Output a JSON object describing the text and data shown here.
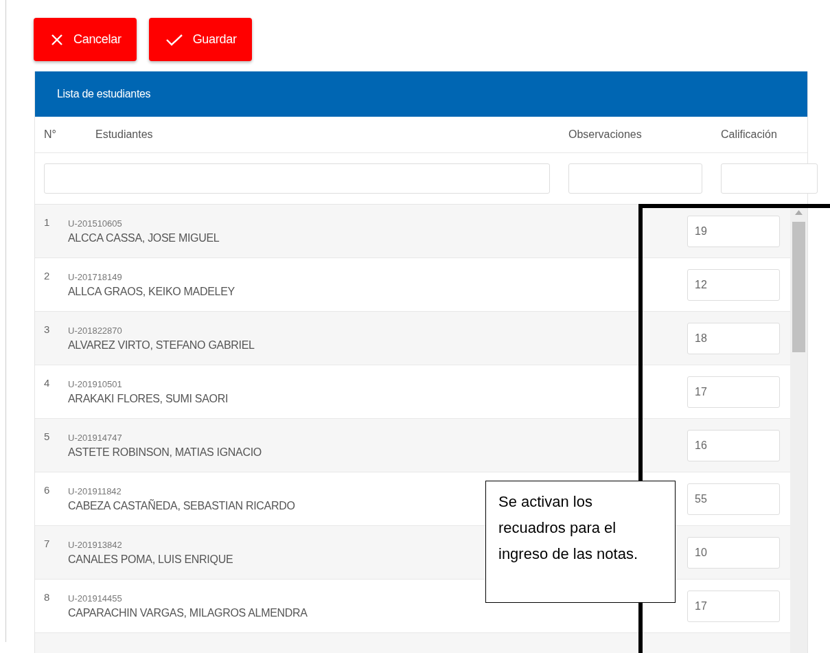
{
  "actions": [
    {
      "kind": "cancel",
      "label": "Cancelar"
    },
    {
      "kind": "save",
      "label": "Guardar"
    }
  ],
  "panel": {
    "title": "Lista de estudiantes",
    "columns": [
      "N°",
      "Estudiantes",
      "Observaciones",
      "Calificación"
    ]
  },
  "students": [
    {
      "number": "1",
      "code": "U-201510605",
      "name": "ALCCA CASSA, JOSE MIGUEL",
      "grade": "19"
    },
    {
      "number": "2",
      "code": "U-201718149",
      "name": "ALLCA GRAOS, KEIKO MADELEY",
      "grade": "12"
    },
    {
      "number": "3",
      "code": "U-201822870",
      "name": "ALVAREZ VIRTO, STEFANO GABRIEL",
      "grade": "18"
    },
    {
      "number": "4",
      "code": "U-201910501",
      "name": "ARAKAKI FLORES, SUMI SAORI",
      "grade": "17"
    },
    {
      "number": "5",
      "code": "U-201914747",
      "name": "ASTETE ROBINSON, MATIAS IGNACIO",
      "grade": "16"
    },
    {
      "number": "6",
      "code": "U-201911842",
      "name": "CABEZA CASTAÑEDA, SEBASTIAN RICARDO",
      "grade": "55"
    },
    {
      "number": "7",
      "code": "U-201913842",
      "name": "CANALES POMA, LUIS ENRIQUE",
      "grade": "10"
    },
    {
      "number": "8",
      "code": "U-201914455",
      "name": "CAPARACHIN VARGAS, MILAGROS ALMENDRA",
      "grade": "17"
    }
  ],
  "callout": {
    "text": "Se activan los recuadros para el ingreso de las notas."
  }
}
